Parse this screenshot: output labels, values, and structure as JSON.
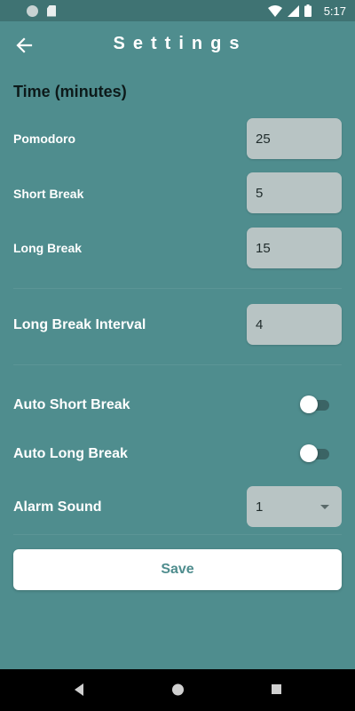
{
  "status_bar": {
    "time": "5:17",
    "icons": [
      "circle-notification-icon",
      "sd-card-icon",
      "wifi-icon",
      "cell-signal-icon",
      "battery-icon"
    ]
  },
  "app_bar": {
    "title": "Settings",
    "back_icon": "arrow-left-icon"
  },
  "time_section": {
    "title": "Time (minutes)",
    "pomodoro": {
      "label": "Pomodoro",
      "value": "25"
    },
    "short_break": {
      "label": "Short Break",
      "value": "5"
    },
    "long_break": {
      "label": "Long Break",
      "value": "15"
    }
  },
  "long_break_interval": {
    "label": "Long Break Interval",
    "value": "4"
  },
  "auto_short_break": {
    "label": "Auto Short Break",
    "enabled": false
  },
  "auto_long_break": {
    "label": "Auto Long Break",
    "enabled": false
  },
  "alarm_sound": {
    "label": "Alarm Sound",
    "selected": "1"
  },
  "save_button": {
    "label": "Save"
  },
  "nav_bar": {
    "icons": [
      "nav-back-icon",
      "nav-home-icon",
      "nav-recents-icon"
    ]
  },
  "colors": {
    "background": "#4f8d8e",
    "status_bar": "#3f7373",
    "field_background": "#b8c4c4",
    "save_text": "#4f8d8e",
    "section_title": "#0d1a1a"
  }
}
